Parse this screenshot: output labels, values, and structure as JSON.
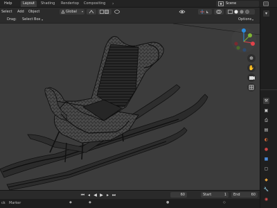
{
  "menubar": {
    "help": "Help",
    "workspaces": [
      "Layout",
      "Shading",
      "Rendertop",
      "Compositing"
    ],
    "active_workspace": "Layout",
    "scene": "Scene"
  },
  "header": {
    "select": "Select",
    "add": "Add",
    "object": "Object",
    "orientation": "Global"
  },
  "toolheader": {
    "drag_label": "Drag:",
    "drag_value": "Select Box",
    "options": "Options"
  },
  "timeline": {
    "playback": "ck",
    "marker": "Marker",
    "current_frame": "60",
    "start_label": "Start",
    "start_value": "1",
    "end_label": "End",
    "end_value": "60"
  },
  "colors": {
    "gizmo_x": "#e0424a",
    "gizmo_y": "#7fb634",
    "gizmo_z": "#2b8de0",
    "viewport_bg": "#3c3c3c"
  },
  "icons": {
    "hand": "hand-icon",
    "zoom": "zoom-icon",
    "camera": "camera-icon",
    "grid": "grid-icon"
  }
}
